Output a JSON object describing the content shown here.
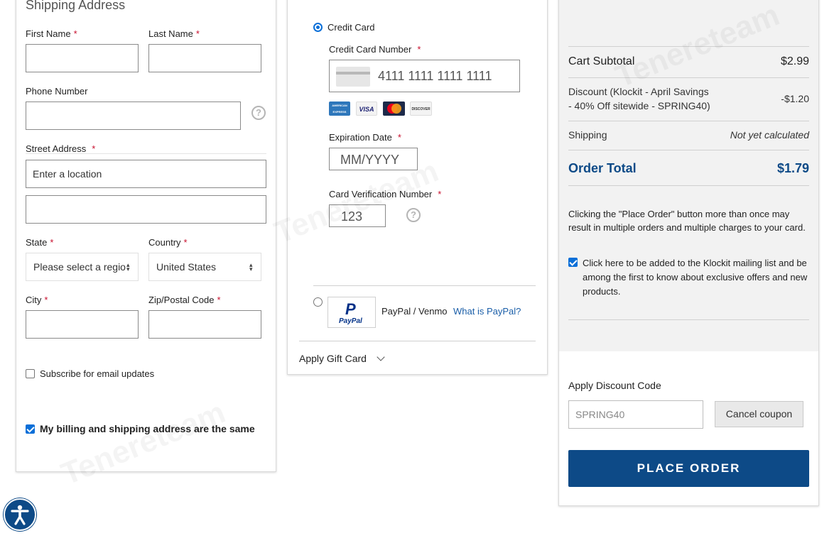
{
  "shipping": {
    "title": "Shipping Address",
    "first_name_label": "First Name",
    "last_name_label": "Last Name",
    "phone_label": "Phone Number",
    "street_label": "Street Address",
    "street_placeholder": "Enter a location",
    "state_label": "State",
    "state_value": "Please select a regio",
    "country_label": "Country",
    "country_value": "United States",
    "city_label": "City",
    "zip_label": "Zip/Postal Code",
    "required_mark": "*",
    "subscribe_label": "Subscribe for email updates",
    "subscribe_checked": false,
    "billing_same_label": "My billing and shipping address are the same",
    "billing_same_checked": true
  },
  "payment": {
    "credit_card_label": "Credit Card",
    "credit_card_selected": true,
    "card_number_label": "Credit Card Number",
    "card_number_placeholder": "4111 1111 1111 1111",
    "card_logos": [
      {
        "name": "american-express",
        "text": "AMERICAN EXPRESS",
        "color": "#2e77bb"
      },
      {
        "name": "visa",
        "text": "VISA",
        "color": "#1a1f71"
      },
      {
        "name": "mastercard",
        "text": "",
        "color": "#eb001b"
      },
      {
        "name": "discover",
        "text": "DISCOVER",
        "color": "#f58220"
      }
    ],
    "expiration_label": "Expiration Date",
    "expiration_placeholder": "MM/YYYY",
    "cvv_label": "Card Verification Number",
    "cvv_placeholder": "123",
    "paypal_logo_text": "PayPal",
    "paypal_label": "PayPal / Venmo",
    "paypal_link": "What is PayPal?",
    "gift_card_label": "Apply Gift Card"
  },
  "summary": {
    "subtotal_label": "Cart Subtotal",
    "subtotal_value": "$2.99",
    "discount_label_line1": "Discount (Klockit - April Savings",
    "discount_label_line2": "- 40% Off sitewide - SPRING40)",
    "discount_value": "-$1.20",
    "shipping_label": "Shipping",
    "shipping_value": "Not yet calculated",
    "total_label": "Order Total",
    "total_value": "$1.79",
    "notice_line1": "Clicking the \"Place Order\" button more than once may",
    "notice_line2": "result in multiple orders and multiple charges to your card.",
    "mailing_line1": "Click here to be added to the Klockit mailing list and be",
    "mailing_line2": "among the first to know about exclusive offers and new",
    "mailing_line3": "products.",
    "mailing_checked": true,
    "discount_code_label": "Apply Discount Code",
    "discount_code_value": "SPRING40",
    "cancel_coupon_label": "Cancel coupon",
    "place_order_label": "PLACE ORDER"
  },
  "watermark": "Tenereteam",
  "colors": {
    "accent_blue": "#0d4a87",
    "link_blue": "#1a5ea8",
    "required_red": "#c8102e",
    "checkbox_blue": "#0a6fd8"
  }
}
